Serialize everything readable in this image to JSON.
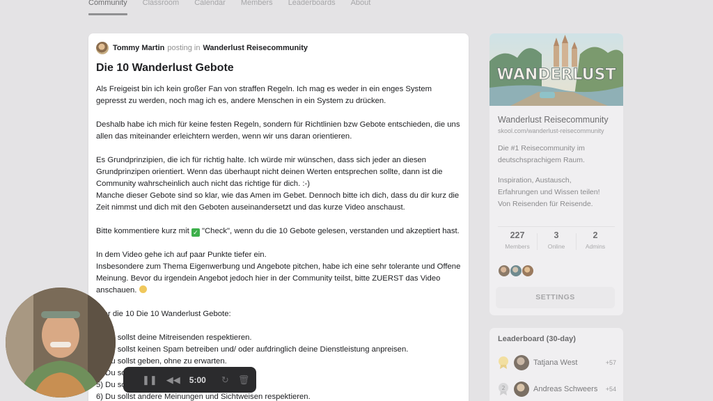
{
  "nav": {
    "tabs": [
      {
        "label": "Community",
        "active": true
      },
      {
        "label": "Classroom"
      },
      {
        "label": "Calendar"
      },
      {
        "label": "Members"
      },
      {
        "label": "Leaderboards"
      },
      {
        "label": "About"
      }
    ]
  },
  "post": {
    "author": "Tommy Martin",
    "posting_in": "posting in",
    "community": "Wanderlust Reisecommunity",
    "title": "Die 10 Wanderlust Gebote",
    "paragraphs": [
      [
        "Als Freigeist bin ich kein großer Fan von straffen Regeln. Ich mag es weder in ein enges System",
        "gepresst zu werden, noch mag ich es, andere Menschen in ein System zu drücken."
      ],
      [
        "Deshalb habe ich mich für keine festen Regeln, sondern für Richtlinien bzw Gebote entschieden, die uns",
        "allen das miteinander erleichtern werden, wenn wir uns daran orientieren."
      ],
      [
        "Es Grundprinzipien, die ich für richtig halte. Ich würde mir wünschen, dass sich jeder an diesen",
        "Grundprinzipen orientiert. Wenn das überhaupt nicht deinen Werten entsprechen sollte, dann ist die",
        "Community wahrscheinlich auch nicht das richtige für dich. :-)",
        "Manche dieser Gebote sind so klar, wie das Amen im Gebet. Dennoch bitte ich dich, dass du dir kurz die",
        "Zeit nimmst und dich mit den Geboten auseinandersetzt und das kurze Video anschaust."
      ],
      [
        "CHECK_LINE"
      ],
      [
        "In dem Video gehe ich auf paar Punkte tiefer ein.",
        "Insbesondere zum Thema Eigenwerbung und Angebote pitchen, habe ich eine sehr tolerante und Offene",
        "Meinung. Bevor du irgendein Angebot jedoch hier in der Community teilst, bitte ZUERST das Video",
        "anschauen. EMOJI"
      ],
      [
        "Hier die 10 Die 10 Wanderlust Gebote:"
      ],
      [
        "1) Du sollst deine Mitreisenden respektieren.",
        "2) Du sollst keinen Spam betreiben und/ oder aufdringlich deine Dienstleistung anpreisen.",
        "3) Du sollst geben, ohne zu erwarten.",
        "4) Du sollst ... (positiv, wie herausfordernd).",
        "5) Du sollst ...",
        "6) Du sollst andere Meinungen und Sichtweisen respektieren."
      ]
    ],
    "check_line_before": "Bitte kommentiere kurz mit ",
    "check_line_after": " \"Check\", wenn du die 10 Gebote gelesen, verstanden und akzeptiert hast."
  },
  "community_card": {
    "cover_text": "WANDERLUST",
    "name": "Wanderlust Reisecommunity",
    "url": "skool.com/wanderlust-reisecommunity",
    "desc1": "Die #1 Reisecommunity im\ndeutschsprachigem Raum.",
    "desc2": "Inspiration, Austausch,\nErfahrungen und Wissen teilen!\nVon Reisenden für Reisende.",
    "stats": [
      {
        "n": "227",
        "label": "Members"
      },
      {
        "n": "3",
        "label": "Online"
      },
      {
        "n": "2",
        "label": "Admins"
      }
    ],
    "settings_label": "SETTINGS"
  },
  "leaderboard": {
    "title": "Leaderboard (30-day)",
    "rows": [
      {
        "name": "Tatjana West",
        "points": "+57"
      },
      {
        "name": "Andreas Schweers",
        "points": "+54"
      }
    ]
  },
  "recorder": {
    "time": "5:00"
  }
}
